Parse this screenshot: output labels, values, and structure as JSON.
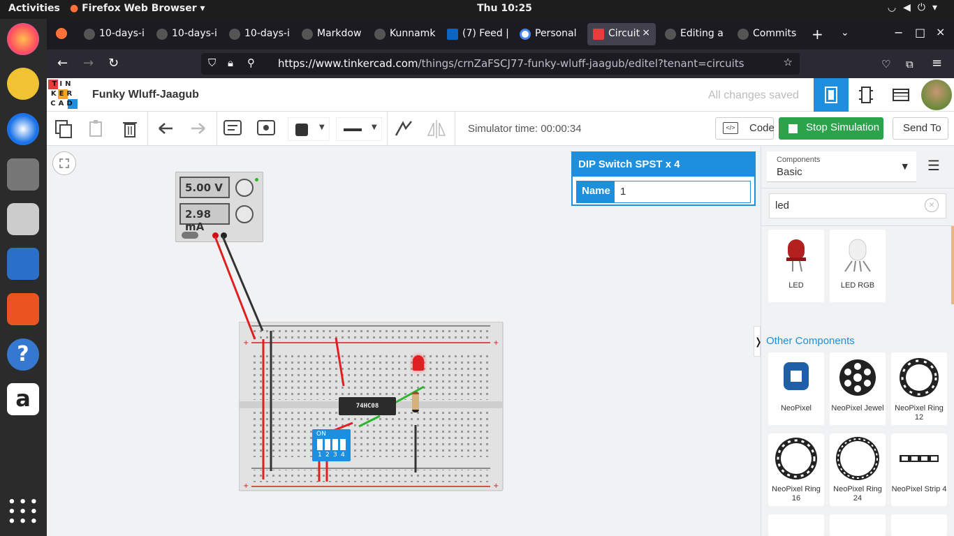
{
  "topbar": {
    "activities": "Activities",
    "app_name": "Firefox Web Browser",
    "clock": "Thu 10:25"
  },
  "browser": {
    "tabs": [
      {
        "label": "10-days-i"
      },
      {
        "label": "10-days-i"
      },
      {
        "label": "10-days-i"
      },
      {
        "label": "Markdow"
      },
      {
        "label": "Kunnamk"
      },
      {
        "label": "(7) Feed |"
      },
      {
        "label": "Personal"
      },
      {
        "label": "Circuit"
      },
      {
        "label": "Editing a"
      },
      {
        "label": "Commits"
      }
    ],
    "url_host": "https://www.tinkercad.com",
    "url_path": "/things/crnZaFSCJ77-funky-wluff-jaagub/editel?tenant=circuits"
  },
  "app": {
    "logo_letters": [
      "TIN",
      "KER",
      "CAD"
    ],
    "title": "Funky Wluff-Jaagub",
    "saved_status": "All changes saved"
  },
  "toolbar": {
    "sim_time": "Simulator time: 00:00:34",
    "code_label": "Code",
    "stop_label": "Stop Simulation",
    "send_label": "Send To"
  },
  "power_supply": {
    "voltage": "5.00 V",
    "current": "2.98 mA"
  },
  "chip_label": "74HC08",
  "dip_label": "ON",
  "dip_numbers": [
    "1",
    "2",
    "3",
    "4"
  ],
  "inspector": {
    "title": "DIP Switch SPST x 4",
    "name_label": "Name",
    "name_value": "1"
  },
  "components": {
    "select_label": "Components",
    "select_value": "Basic",
    "search_value": "led",
    "other_heading": "Other Components",
    "items": [
      {
        "label": "LED"
      },
      {
        "label": "LED RGB"
      },
      {
        "label": "NeoPixel"
      },
      {
        "label": "NeoPixel Jewel"
      },
      {
        "label": "NeoPixel Ring 12"
      },
      {
        "label": "NeoPixel Ring 16"
      },
      {
        "label": "NeoPixel Ring 24"
      },
      {
        "label": "NeoPixel Strip 4"
      }
    ]
  },
  "colors": {
    "accent": "#1e8fdc",
    "stop": "#2aa34a",
    "wire_red": "#e02020",
    "wire_black": "#333333",
    "wire_green": "#2db52d"
  }
}
